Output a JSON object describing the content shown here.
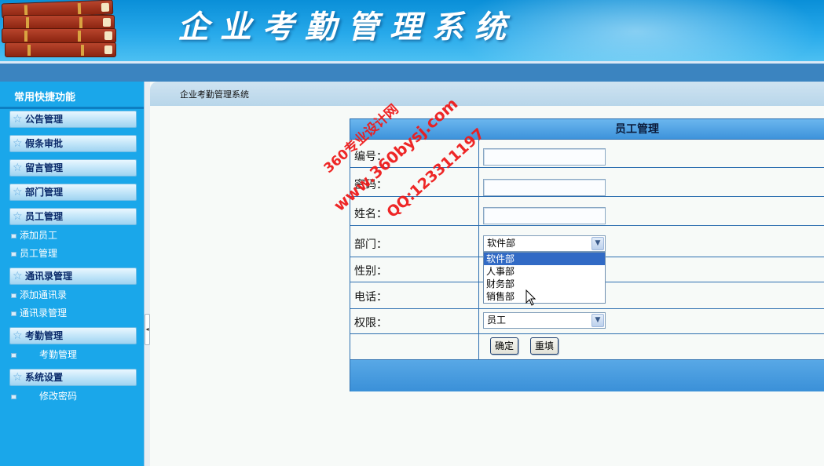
{
  "header": {
    "title": "企业考勤管理系统"
  },
  "sidebar": {
    "title": "常用快捷功能",
    "groups": [
      {
        "label": "公告管理",
        "items": []
      },
      {
        "label": "假条审批",
        "items": []
      },
      {
        "label": "留言管理",
        "items": []
      },
      {
        "label": "部门管理",
        "items": []
      },
      {
        "label": "员工管理",
        "items": [
          "添加员工",
          "员工管理"
        ]
      },
      {
        "label": "通讯录管理",
        "items": [
          "添加通讯录",
          "通讯录管理"
        ]
      },
      {
        "label": "考勤管理",
        "items": [
          "考勤管理"
        ]
      },
      {
        "label": "系统设置",
        "items": [
          "修改密码"
        ]
      }
    ]
  },
  "breadcrumb": "企业考勤管理系统",
  "form": {
    "title": "员工管理",
    "fields": {
      "id": {
        "label": "编号：",
        "value": ""
      },
      "password": {
        "label": "密码：",
        "value": ""
      },
      "name": {
        "label": "姓名：",
        "value": ""
      },
      "department": {
        "label": "部门：",
        "selected": "软件部",
        "options": [
          "软件部",
          "人事部",
          "财务部",
          "销售部"
        ]
      },
      "gender": {
        "label": "性别："
      },
      "phone": {
        "label": "电话："
      },
      "role": {
        "label": "权限：",
        "selected": "员工"
      }
    },
    "buttons": {
      "submit": "确定",
      "reset": "重填"
    }
  },
  "watermark": {
    "line1": "360专业设计网",
    "line2": "www.360bysj.com",
    "line3": "QQ:123311197"
  },
  "colors": {
    "header": "#1aa0e6",
    "sidebar": "#1aa7ea",
    "table_border": "#2d6fb0",
    "watermark": "#ee1b1b"
  }
}
